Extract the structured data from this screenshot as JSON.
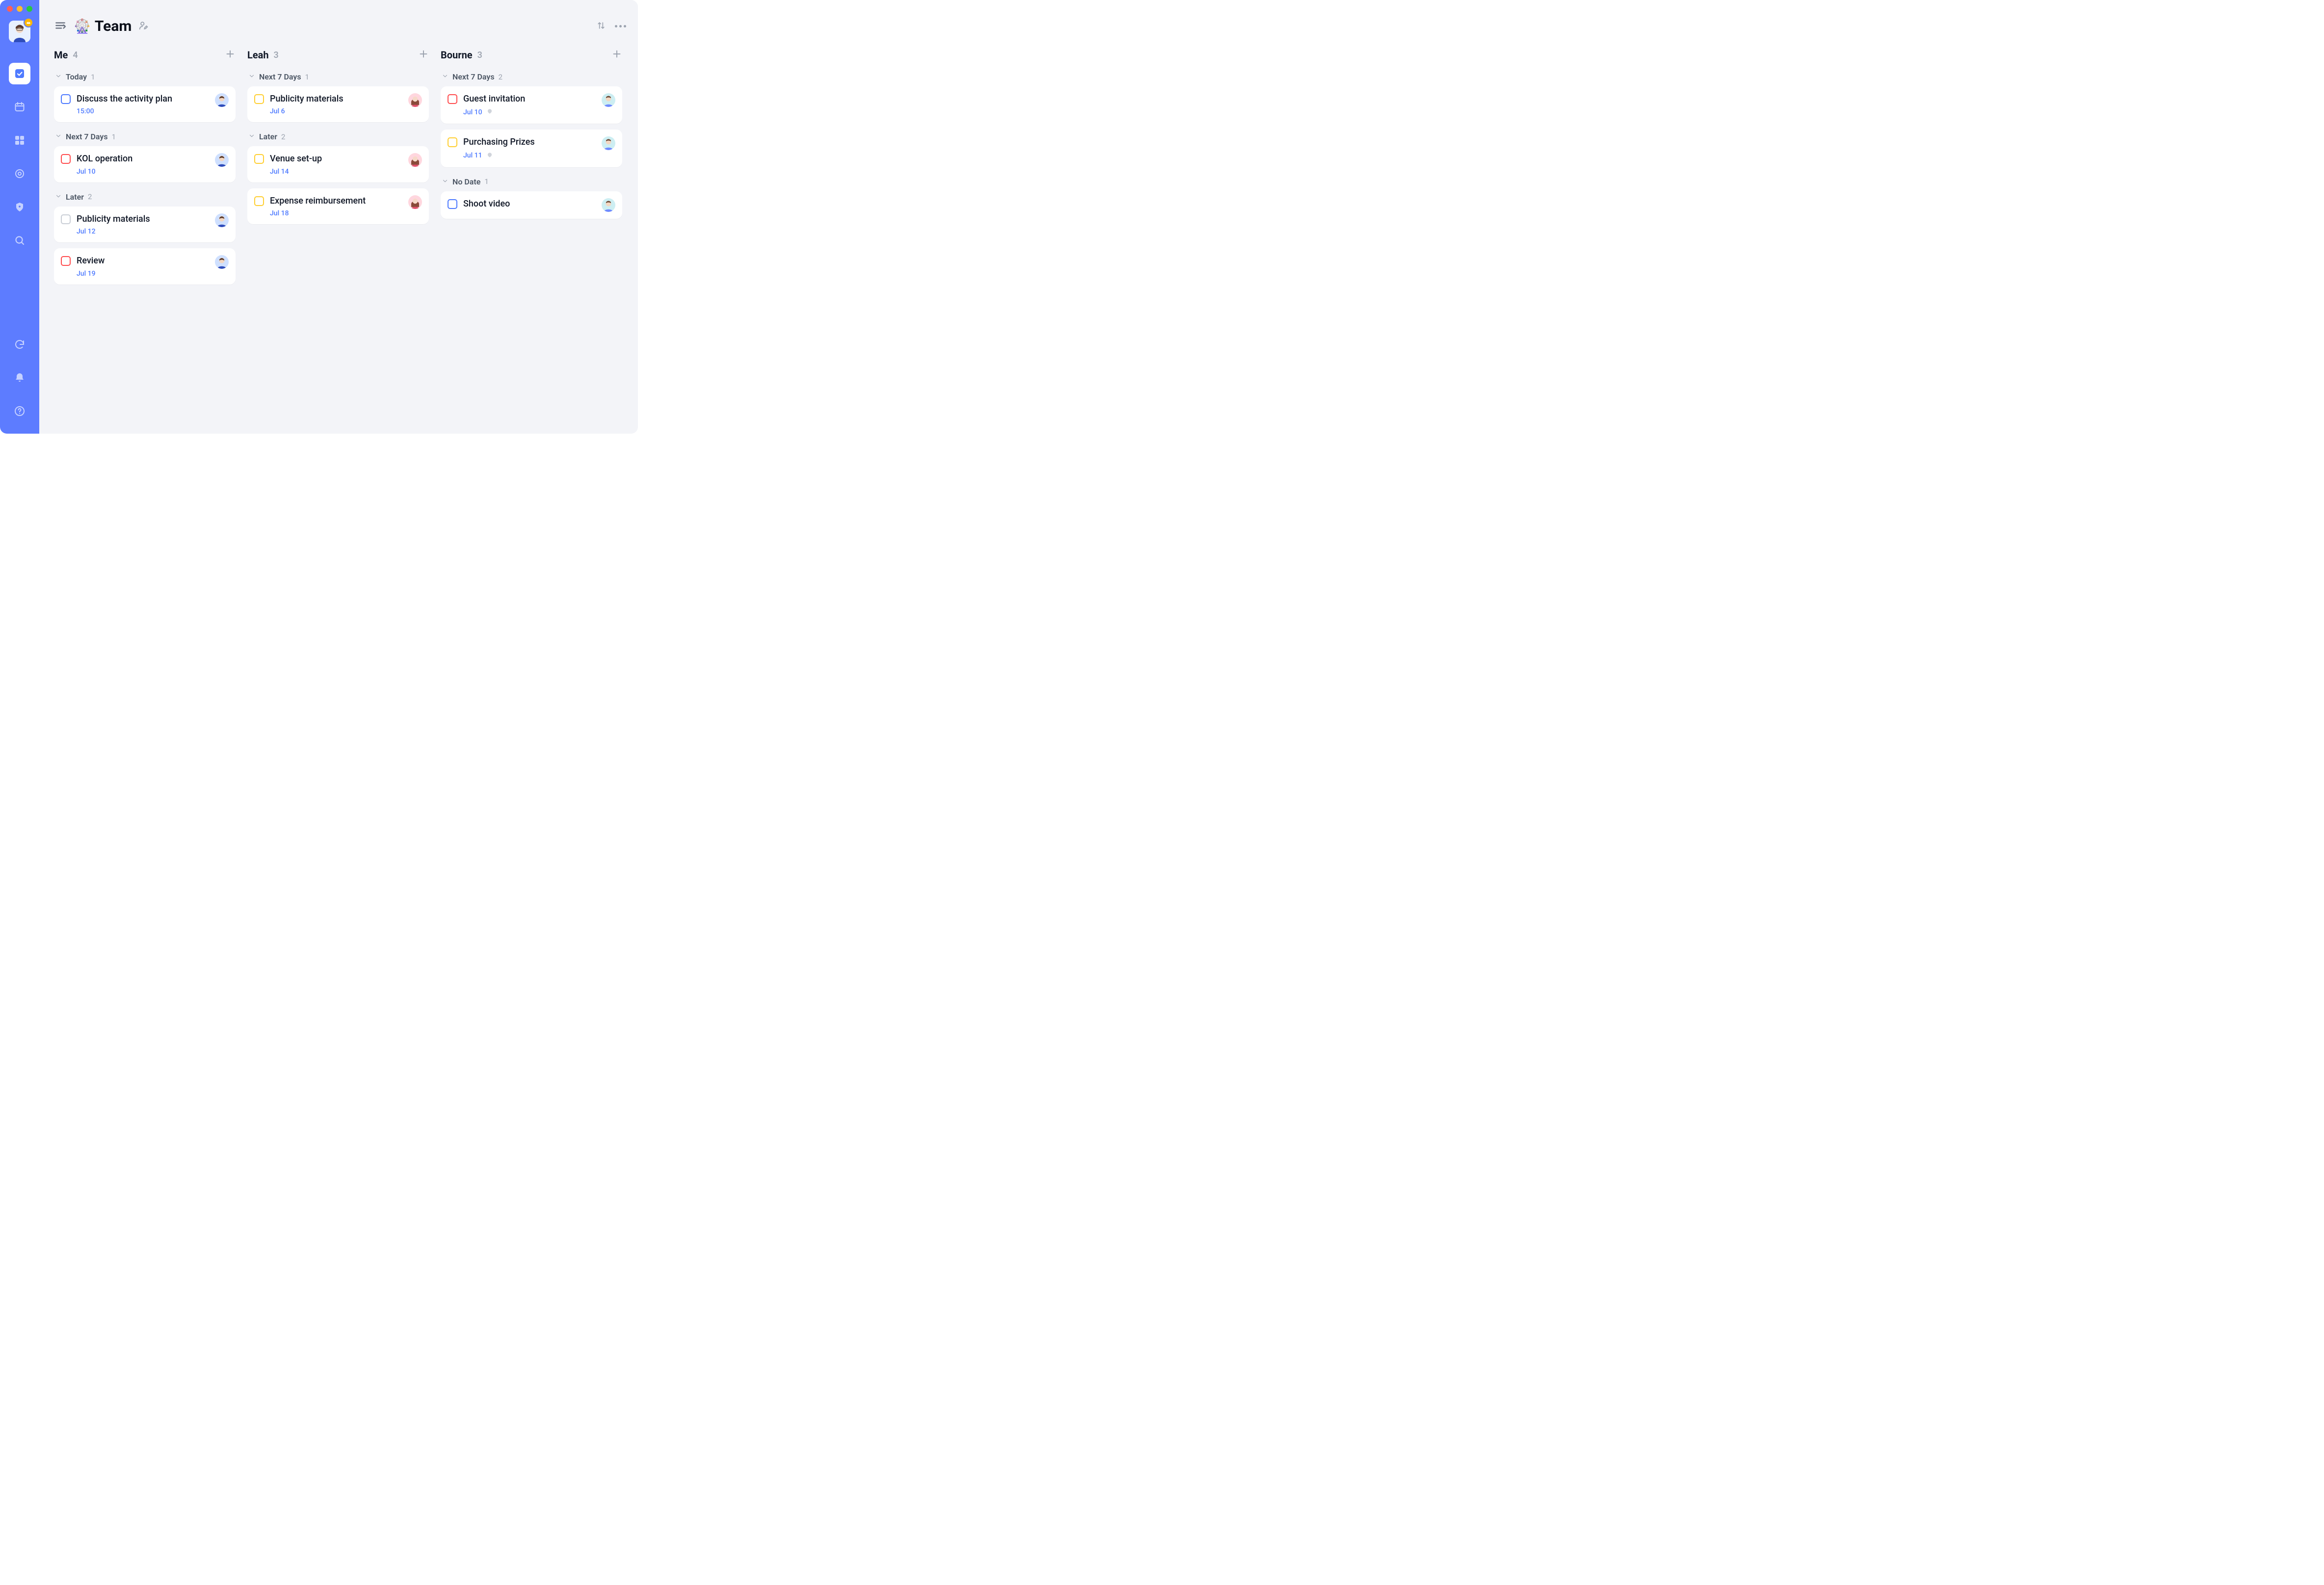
{
  "header": {
    "emoji": "🎡",
    "title": "Team"
  },
  "columns": [
    {
      "name": "Me",
      "count": "4",
      "groups": [
        {
          "title": "Today",
          "count": "1",
          "cards": [
            {
              "title": "Discuss the activity plan",
              "date": "15:00",
              "priority": "blue",
              "assignee": "me",
              "alarm": false
            }
          ]
        },
        {
          "title": "Next 7 Days",
          "count": "1",
          "cards": [
            {
              "title": "KOL operation",
              "date": "Jul 10",
              "priority": "red",
              "assignee": "me",
              "alarm": false
            }
          ]
        },
        {
          "title": "Later",
          "count": "2",
          "cards": [
            {
              "title": "Publicity materials",
              "date": "Jul 12",
              "priority": "gray",
              "assignee": "me",
              "alarm": false
            },
            {
              "title": "Review",
              "date": "Jul 19",
              "priority": "red",
              "assignee": "me",
              "alarm": false
            }
          ]
        }
      ]
    },
    {
      "name": "Leah",
      "count": "3",
      "groups": [
        {
          "title": "Next 7 Days",
          "count": "1",
          "cards": [
            {
              "title": "Publicity materials",
              "date": "Jul 6",
              "priority": "yellow",
              "assignee": "leah",
              "alarm": false
            }
          ]
        },
        {
          "title": "Later",
          "count": "2",
          "cards": [
            {
              "title": "Venue set-up",
              "date": "Jul 14",
              "priority": "yellow",
              "assignee": "leah",
              "alarm": false
            },
            {
              "title": "Expense reimbursement",
              "date": "Jul 18",
              "priority": "yellow",
              "assignee": "leah",
              "alarm": false
            }
          ]
        }
      ]
    },
    {
      "name": "Bourne",
      "count": "3",
      "groups": [
        {
          "title": "Next 7 Days",
          "count": "2",
          "cards": [
            {
              "title": "Guest invitation",
              "date": "Jul 10",
              "priority": "red",
              "assignee": "bourne",
              "alarm": true
            },
            {
              "title": "Purchasing Prizes",
              "date": "Jul 11",
              "priority": "yellow",
              "assignee": "bourne",
              "alarm": true
            }
          ]
        },
        {
          "title": "No Date",
          "count": "1",
          "cards": [
            {
              "title": "Shoot video",
              "date": "",
              "priority": "blue",
              "assignee": "bourne",
              "alarm": false
            }
          ]
        }
      ]
    }
  ]
}
